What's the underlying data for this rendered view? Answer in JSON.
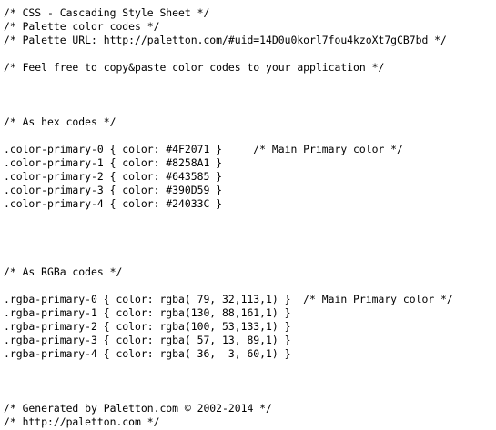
{
  "header": {
    "line1": "/* CSS - Cascading Style Sheet */",
    "line2": "/* Palette color codes */",
    "line3": "/* Palette URL: http://paletton.com/#uid=14D0u0korl7fou4kzoXt7gCB7bd */",
    "line4": "/* Feel free to copy&paste color codes to your application */"
  },
  "hex_section": {
    "title": "/* As hex codes */",
    "rows": [
      ".color-primary-0 { color: #4F2071 }     /* Main Primary color */",
      ".color-primary-1 { color: #8258A1 }",
      ".color-primary-2 { color: #643585 }",
      ".color-primary-3 { color: #390D59 }",
      ".color-primary-4 { color: #24033C }"
    ]
  },
  "rgba_section": {
    "title": "/* As RGBa codes */",
    "rows": [
      ".rgba-primary-0 { color: rgba( 79, 32,113,1) }  /* Main Primary color */",
      ".rgba-primary-1 { color: rgba(130, 88,161,1) }",
      ".rgba-primary-2 { color: rgba(100, 53,133,1) }",
      ".rgba-primary-3 { color: rgba( 57, 13, 89,1) }",
      ".rgba-primary-4 { color: rgba( 36,  3, 60,1) }"
    ]
  },
  "footer": {
    "line1": "/* Generated by Paletton.com © 2002-2014 */",
    "line2": "/* http://paletton.com */"
  }
}
